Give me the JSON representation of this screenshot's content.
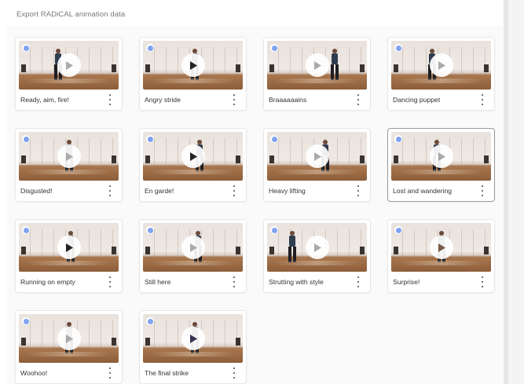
{
  "page": {
    "title": "Export RADiCAL animation data"
  },
  "colors": {
    "accent_dot": "#7fa3f2",
    "card_border": "#e8e8e8",
    "selected_border": "#9a9a9a",
    "text": "#333333"
  },
  "icons": {
    "play": "play-icon",
    "more": "more-vertical-icon",
    "select": "select-radio-icon"
  },
  "animations": [
    {
      "title": "Ready, aim, fire!",
      "selected": false
    },
    {
      "title": "Angry stride",
      "selected": false
    },
    {
      "title": "Braaaaaains",
      "selected": false
    },
    {
      "title": "Dancing puppet",
      "selected": false
    },
    {
      "title": "Disgusted!",
      "selected": false
    },
    {
      "title": "En garde!",
      "selected": false
    },
    {
      "title": "Heavy lifting",
      "selected": false
    },
    {
      "title": "Lost and wandering",
      "selected": true
    },
    {
      "title": "Running on empty",
      "selected": false
    },
    {
      "title": "Still here",
      "selected": false
    },
    {
      "title": "Strutting with style",
      "selected": false
    },
    {
      "title": "Surprise!",
      "selected": false
    },
    {
      "title": "Woohoo!",
      "selected": false
    },
    {
      "title": "The final strike",
      "selected": false
    }
  ]
}
